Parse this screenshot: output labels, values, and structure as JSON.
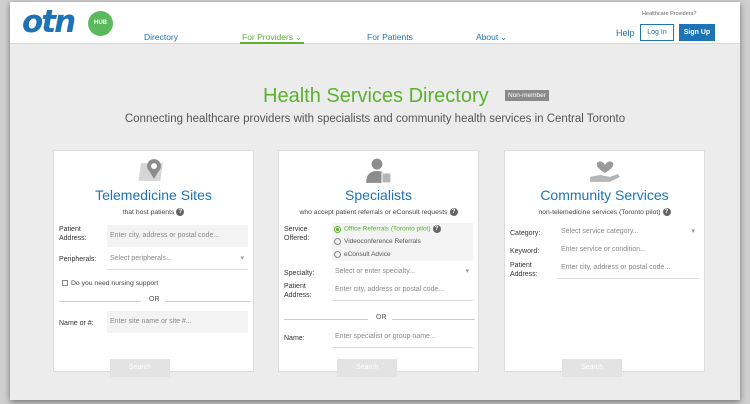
{
  "header": {
    "logo_text": "otn",
    "logo_badge": "HUB",
    "nav": [
      {
        "label": "Directory"
      },
      {
        "label": "For Providers"
      },
      {
        "label": "For Patients"
      },
      {
        "label": "About"
      }
    ],
    "providers_prompt": "Healthcare Providers?",
    "help_label": "Help",
    "login_label": "Log In",
    "signup_label": "Sign Up",
    "accent_color": "#1d73b4",
    "active_color": "#5cb130"
  },
  "page": {
    "title": "Health Services Directory",
    "badge": "Non-member",
    "subtitle": "Connecting healthcare providers with specialists and community health services in Central Toronto"
  },
  "cards": {
    "telemedicine": {
      "icon": "map-pin-icon",
      "title": "Telemedicine Sites",
      "subtitle": "that host patients",
      "patient_address_label": "Patient Address:",
      "patient_address_placeholder": "Enter city, address or postal code...",
      "peripherals_label": "Peripherals:",
      "peripherals_placeholder": "Select peripherals...",
      "nursing_label": "Do you need nursing support",
      "or_label": "OR",
      "name_label": "Name or #:",
      "name_placeholder": "Enter site name or site #...",
      "search_label": "Search"
    },
    "specialists": {
      "icon": "doctor-icon",
      "title": "Specialists",
      "subtitle": "who accept patient referrals or eConsult requests",
      "service_label": "Service Offered:",
      "options": [
        {
          "label": "Office Referrals (Toronto pilot)",
          "selected": true
        },
        {
          "label": "Videoconference Referrals",
          "selected": false
        },
        {
          "label": "eConsult Advice",
          "selected": false
        }
      ],
      "specialty_label": "Specialty:",
      "specialty_placeholder": "Select or enter specialty...",
      "patient_address_label": "Patient Address:",
      "patient_address_placeholder": "Enter city, address or postal code...",
      "or_label": "OR",
      "name_label": "Name:",
      "name_placeholder": "Enter specialist or group name...",
      "search_label": "Search"
    },
    "community": {
      "icon": "hand-heart-icon",
      "title": "Community Services",
      "subtitle": "non-telemedicine services (Toronto pilot)",
      "category_label": "Category:",
      "category_placeholder": "Select service category...",
      "keyword_label": "Keyword:",
      "keyword_placeholder": "Enter service or condition...",
      "patient_address_label": "Patient Address:",
      "patient_address_placeholder": "Enter city, address or postal code...",
      "search_label": "Search"
    }
  }
}
